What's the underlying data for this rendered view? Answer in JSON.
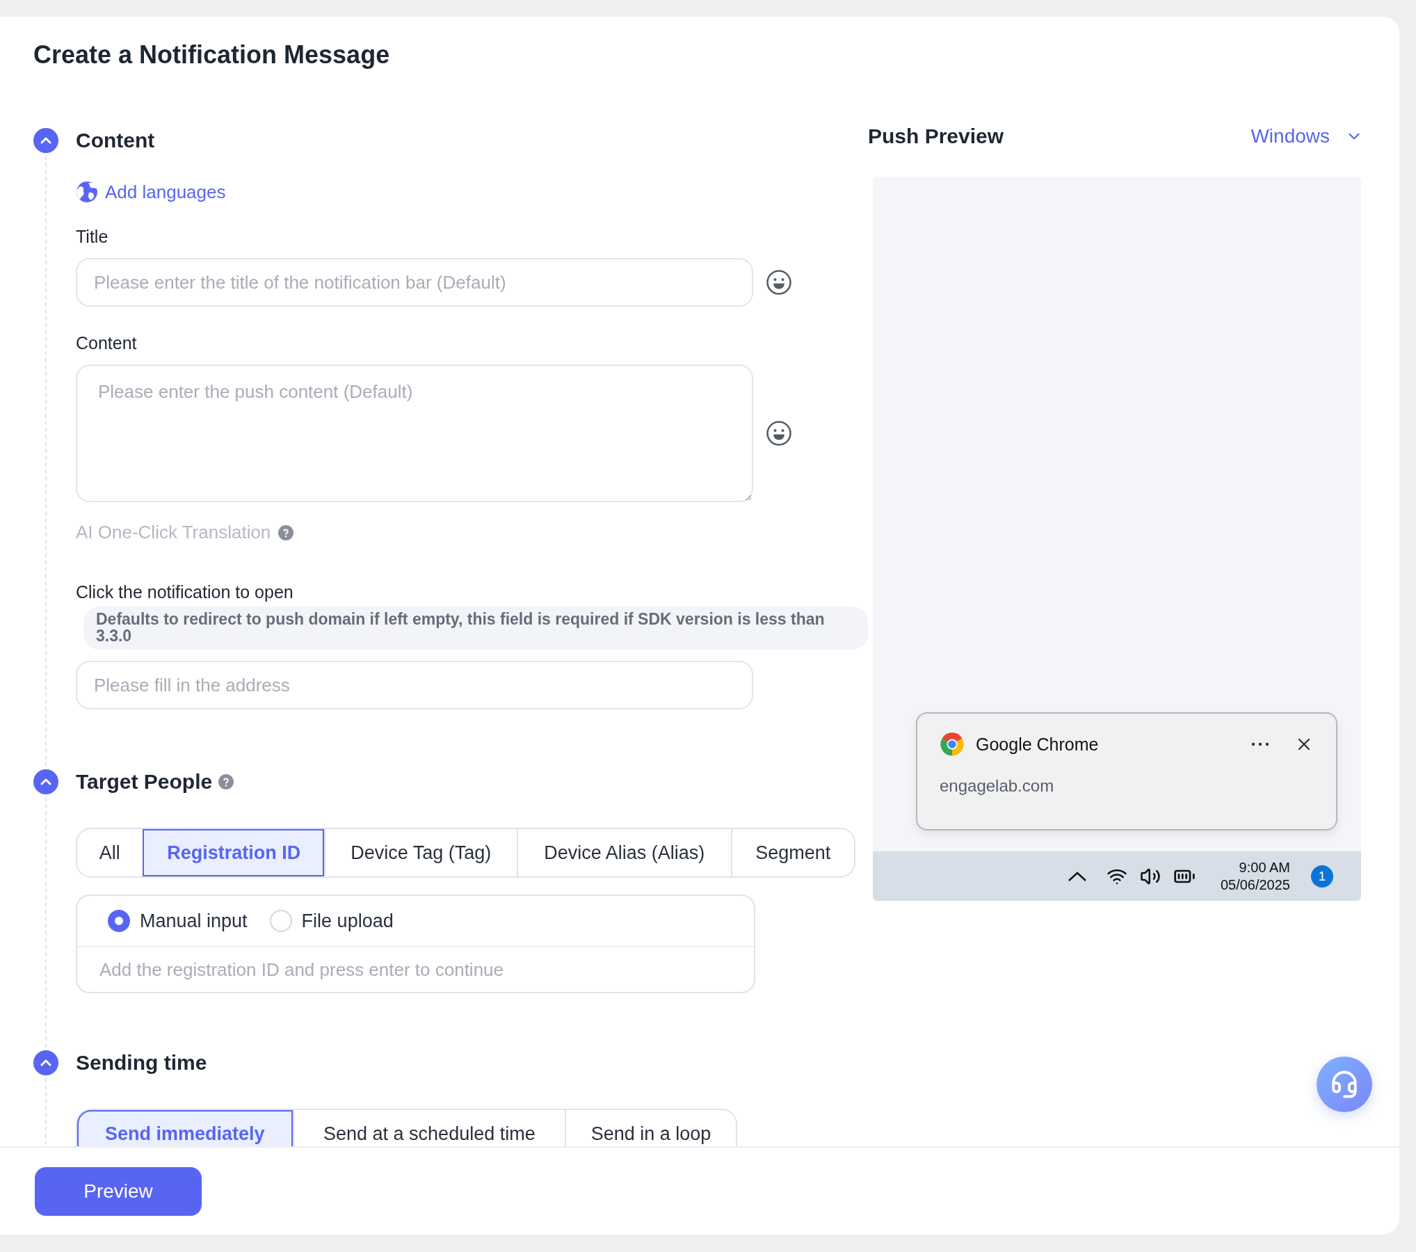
{
  "page": {
    "title": "Create a Notification Message"
  },
  "content_section": {
    "heading": "Content",
    "expanded": true,
    "add_languages": "Add languages",
    "title_label": "Title",
    "title_placeholder": "Please enter the title of the notification bar (Default)",
    "content_label": "Content",
    "content_placeholder": "Please enter the push content (Default)",
    "ai_translation": {
      "label": "AI One-Click Translation",
      "disabled": true
    },
    "click_label": "Click the notification to open",
    "click_hint": "Defaults to redirect to push domain if left empty, this field is required if SDK version is less than 3.3.0",
    "address_placeholder": "Please fill in the address"
  },
  "target_section": {
    "heading": "Target People",
    "expanded": true,
    "tabs": [
      {
        "label": "All",
        "selected": false
      },
      {
        "label": "Registration ID",
        "selected": true
      },
      {
        "label": "Device Tag (Tag)",
        "selected": false
      },
      {
        "label": "Device Alias (Alias)",
        "selected": false
      },
      {
        "label": "Segment",
        "selected": false
      }
    ],
    "input_modes": [
      {
        "label": "Manual input",
        "selected": true
      },
      {
        "label": "File upload",
        "selected": false
      }
    ],
    "placeholder": "Add the registration ID and press enter to continue"
  },
  "sending_section": {
    "heading": "Sending time",
    "expanded": true,
    "tabs": [
      {
        "label": "Send immediately",
        "selected": true
      },
      {
        "label": "Send at a scheduled time",
        "selected": false
      },
      {
        "label": "Send in a loop",
        "selected": false
      }
    ]
  },
  "preview": {
    "heading": "Push Preview",
    "platform": "Windows",
    "notification": {
      "app": "Google Chrome",
      "site": "engagelab.com"
    },
    "taskbar": {
      "time": "9:00 AM",
      "date": "05/06/2025",
      "badge": "1"
    }
  },
  "footer": {
    "preview_button": "Preview"
  }
}
